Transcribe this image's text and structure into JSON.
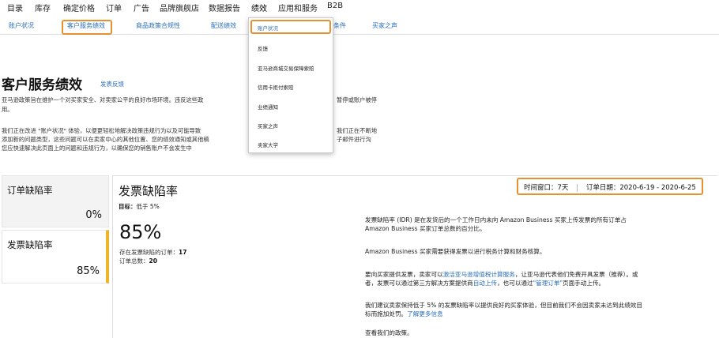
{
  "top_nav": {
    "items": [
      "目录",
      "库存",
      "确定价格",
      "订单",
      "广告",
      "品牌旗舰店",
      "数据报告",
      "绩效",
      "应用和服务",
      "B2B"
    ]
  },
  "sub_nav": {
    "items": [
      "账户状况",
      "客户服务绩效",
      "商品政策合规性",
      "配送绩效",
      "条件",
      "买家之声"
    ]
  },
  "dropdown": {
    "items": [
      "账户状况",
      "反馈",
      "亚马逊商城交易保障索赔",
      "信用卡拒付索赔",
      "业绩通知",
      "买家之声",
      "卖家大学"
    ]
  },
  "page": {
    "title": "客户服务绩效",
    "feedback_link": "发表反馈",
    "intro_lines": [
      "亚马逊政策旨在维护一个对买家安全、对卖家公平的良好市场环境。违反这些政",
      "用。",
      "我们正在改进 \"账户状况\" 体验，以便更轻松地解决政策违规行为以及可能导致",
      "添加新的问题类型，这些问题可以在卖家中心的其他位置、您的绩效通知或其他稿",
      "您应快速解决此页面上的问题和违规行为，以确保您的销售账户不会发生中"
    ],
    "intro_right_lines": [
      "暂停或账户被停",
      "我们正在不断地",
      "子邮件进行沟"
    ]
  },
  "side_cards": [
    {
      "label": "订单缺陷率",
      "value": "0%"
    },
    {
      "label": "发票缺陷率",
      "value": "85%"
    }
  ],
  "panel": {
    "title": "发票缺陷率",
    "target_label": "目标：",
    "target_value": "低于 5%",
    "percentage": "85%",
    "late_invoice_label": "存在发票缺陷的订单：",
    "late_invoice_count": "17",
    "total_orders_label": "订单总数：",
    "total_orders_count": "20",
    "time_window_label": "时间窗口：",
    "time_window_value": "7天",
    "order_date_label": "订单日期：",
    "order_date_value": "2020-6-19 - 2020-6-25"
  },
  "description": {
    "p1_l1": "发票缺陷率 (IDR) 是在发货后的一个工作日内未向 Amazon Business 买家上传发票的所有订单占",
    "p1_l2": "Amazon Business 买家订单总数的百分比。",
    "p2": "Amazon Business 买家需要获得发票以进行税务计算和财务核算。",
    "p3_l1_a": "要向买家提供发票，卖家可以",
    "p3_l1_link": "激活亚马逊增值税计算服务",
    "p3_l1_b": "，让亚马逊代表他们免费开具发票（推荐）。或",
    "p3_l2_a": "者，发票可以通过第三方解决方案提供商",
    "p3_l2_link1": "自动上传",
    "p3_l2_b": "，也可以通过",
    "p3_l2_link2": "\"管理订单\"",
    "p3_l2_c": "页面手动上传。",
    "p4_l1": "我们建议卖家保持低于 5% 的发票缺陷率以提供良好的买家体验，但目前我们不会因卖家未达到此绩效目",
    "p4_l2_a": "标而施加处罚。",
    "p4_l2_link": "了解更多信息",
    "policy_link": "查看我们的政策。"
  },
  "colors": {
    "highlight": "#e6902f",
    "link": "#2a6ebb",
    "active_bar": "#f0b429"
  }
}
